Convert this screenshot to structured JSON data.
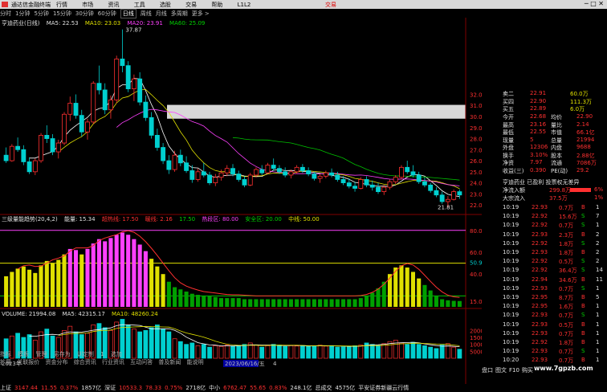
{
  "window": {
    "title": "通达信金融终端",
    "menus": [
      "行情",
      "市场",
      "资讯",
      "工具",
      "选股",
      "交易",
      "帮助",
      "L1L2"
    ],
    "brand": "交易",
    "controls": [
      "─",
      "□",
      "✕"
    ]
  },
  "toolbar": {
    "periods": [
      "分时",
      "1分钟",
      "5分钟",
      "15分钟",
      "30分钟",
      "60分钟",
      "日线",
      "周线",
      "月线",
      "多周期",
      "更多 >"
    ],
    "active": "日线"
  },
  "main_legend": {
    "stock": "亨迪药业(日线)",
    "ma5": "MA5: 22.53",
    "ma10": "MA10: 23.03",
    "ma20": "MA20: 23.91",
    "ma60": "MA60: 25.09",
    "high_label": "37.87",
    "range_label": "31.05 - 29.80",
    "low_label": "21.81"
  },
  "price_axis": [
    "32.00",
    "31.00",
    "30.00",
    "29.00",
    "28.00",
    "27.00",
    "26.00",
    "25.00",
    "24.00",
    "23.00",
    "22.00"
  ],
  "ind_legend": {
    "name": "三级量能趋势(20,4,2)",
    "value": "能量: 15.34",
    "items": [
      "超热线: 17.50",
      "暖线: 2.16",
      "17.50",
      "热段区: 80.00",
      "安全区: 20.00",
      "中线: 50.00"
    ]
  },
  "ind_axis": [
    "80.00",
    "60.00",
    "50.97",
    "40.00",
    "15.00"
  ],
  "vol_legend": {
    "vol": "VOLUME: 21994.08",
    "ma5": "MA5: 42315.17",
    "ma10": "MA10: 48260.24"
  },
  "vol_axis": [
    "20000",
    "15000",
    "10000",
    "5000"
  ],
  "date_labels": [
    "2023年",
    "2023/06/16/五",
    "4"
  ],
  "bottom_tabs": [
    "指标",
    "模板",
    "管理",
    "另存为",
    "训定制",
    "1",
    "选加"
  ],
  "bottom_tabs2": [
    "扩展",
    "关联报价",
    "资金分布",
    "综合资讯",
    "行业资讯",
    "互动问答",
    "普及新闻",
    "能说明"
  ],
  "side_quote": {
    "rows": [
      {
        "l": "卖二",
        "v": "22.91",
        "r": "60.0万"
      },
      {
        "l": "买四",
        "v": "22.90",
        "r": "111.3万"
      },
      {
        "l": "买五",
        "v": "22.89",
        "r": "6.0万"
      },
      {
        "l": "今开",
        "v": "22.68",
        "l2": "均价",
        "v2": "22.90"
      },
      {
        "l": "最高",
        "v": "23.16",
        "l2": "量比",
        "v2": "2.14"
      },
      {
        "l": "最低",
        "v": "22.55",
        "l2": "市值",
        "v2": "66.1亿"
      },
      {
        "l": "现量",
        "v": "5",
        "l2": "总量",
        "v2": "21994"
      },
      {
        "l": "外盘",
        "v": "12306",
        "l2": "内盘",
        "v2": "9688"
      },
      {
        "l": "换手",
        "v": "3.10%",
        "l2": "股本",
        "v2": "2.88亿"
      },
      {
        "l": "净资",
        "v": "7.97",
        "l2": "流通",
        "v2": "7086万"
      },
      {
        "l": "收益(三)",
        "v": "0.390",
        "l2": "PE(动)",
        "v2": "29.2"
      }
    ],
    "news": "亨迪药业 已盈利 投票权无差异",
    "flow1_label": "净流入额",
    "flow1_value": "299.8万",
    "flow1_pct": "6%",
    "flow2_label": "大宗流入",
    "flow2_value": "37.5万",
    "flow2_pct": "1%"
  },
  "ticks": [
    [
      "10:19",
      "22.93",
      "0.7万",
      "B",
      "1"
    ],
    [
      "10:19",
      "22.92",
      "15.6万",
      "S",
      "7"
    ],
    [
      "10:19",
      "22.92",
      "0.7万",
      "S",
      "1"
    ],
    [
      "10:19",
      "22.93",
      "2.3万",
      "B",
      "2"
    ],
    [
      "10:19",
      "22.92",
      "1.8万",
      "S",
      "2"
    ],
    [
      "10:19",
      "22.93",
      "1.8万",
      "B",
      "2"
    ],
    [
      "10:19",
      "22.92",
      "0.5万",
      "S",
      "2"
    ],
    [
      "10:19",
      "22.92",
      "36.4万",
      "S",
      "14"
    ],
    [
      "10:19",
      "22.94",
      "34.6万",
      "B",
      "11"
    ],
    [
      "10:19",
      "22.93",
      "0.7万",
      "S",
      "1"
    ],
    [
      "10:19",
      "22.95",
      "8.7万",
      "B",
      "5"
    ],
    [
      "10:19",
      "22.95",
      "1.6万",
      "B",
      "1"
    ],
    [
      "10:19",
      "22.93",
      "0.7万",
      "S",
      "1"
    ],
    [
      "10:19",
      "22.93",
      "0.5万",
      "B",
      "1"
    ],
    [
      "10:19",
      "22.93",
      "0.7万",
      "B",
      "1"
    ],
    [
      "10:19",
      "22.92",
      "1.8万",
      "B",
      "1"
    ],
    [
      "10:19",
      "22.93",
      "0.7万",
      "S",
      "1"
    ],
    [
      "10:20",
      "22.93",
      "0.7万",
      "B",
      "1"
    ]
  ],
  "side_tabs": [
    "盘口",
    "图文",
    "F10",
    "购买"
  ],
  "status": {
    "items": [
      {
        "name": "上证",
        "price": "3147.44",
        "chg": "11.55",
        "pct": "0.37%",
        "amt": "1857亿"
      },
      {
        "name": "深证",
        "price": "10533.3",
        "chg": "78.33",
        "pct": "0.75%",
        "amt": "2718亿"
      },
      {
        "name": "中小",
        "price": "6762.47",
        "chg": "55.65",
        "pct": "0.83%",
        "amt": "248.1亿"
      }
    ],
    "extra1": "总成交",
    "extra2": "4575亿",
    "extra3": "平安证券新疆云行情"
  },
  "watermark": "www.7gpzb.com",
  "colors": {
    "up": "#ff3030",
    "down": "#00d0d0",
    "ma5": "#ffffff",
    "ma10": "#e0e000",
    "ma20": "#ff40ff",
    "ma60": "#00c000"
  },
  "chart_data": {
    "type": "candlestick",
    "ohlc": [
      [
        26.5,
        27.2,
        25.8,
        26.0
      ],
      [
        26.0,
        27.5,
        25.9,
        27.3
      ],
      [
        27.3,
        28.1,
        26.8,
        27.0
      ],
      [
        27.0,
        27.4,
        25.6,
        25.9
      ],
      [
        25.9,
        26.3,
        24.8,
        25.0
      ],
      [
        25.0,
        26.2,
        24.7,
        26.0
      ],
      [
        26.0,
        28.5,
        25.8,
        28.3
      ],
      [
        28.3,
        29.2,
        27.6,
        28.0
      ],
      [
        28.0,
        28.4,
        26.5,
        26.8
      ],
      [
        26.8,
        27.9,
        26.2,
        27.6
      ],
      [
        27.6,
        30.4,
        27.4,
        30.2
      ],
      [
        30.2,
        31.8,
        29.6,
        31.2
      ],
      [
        31.2,
        32.0,
        29.8,
        30.1
      ],
      [
        30.1,
        30.6,
        28.2,
        28.6
      ],
      [
        28.6,
        29.8,
        27.9,
        29.5
      ],
      [
        29.5,
        33.2,
        29.3,
        33.0
      ],
      [
        33.0,
        34.6,
        32.0,
        32.4
      ],
      [
        32.4,
        33.0,
        30.2,
        30.6
      ],
      [
        30.6,
        31.9,
        29.8,
        31.5
      ],
      [
        31.5,
        35.5,
        31.2,
        35.2
      ],
      [
        35.2,
        37.87,
        34.0,
        34.6
      ],
      [
        34.6,
        35.0,
        32.2,
        32.5
      ],
      [
        32.5,
        33.8,
        31.4,
        33.4
      ],
      [
        33.4,
        34.0,
        31.0,
        31.3
      ],
      [
        31.3,
        31.9,
        29.6,
        29.9
      ],
      [
        29.9,
        30.4,
        28.0,
        28.3
      ],
      [
        28.3,
        28.9,
        26.9,
        27.2
      ],
      [
        27.2,
        27.6,
        25.7,
        26.0
      ],
      [
        26.0,
        26.5,
        24.8,
        25.2
      ],
      [
        25.2,
        26.9,
        25.0,
        26.5
      ],
      [
        26.5,
        27.0,
        25.5,
        25.8
      ],
      [
        25.8,
        26.4,
        24.9,
        25.1
      ],
      [
        25.1,
        25.6,
        24.0,
        24.3
      ],
      [
        24.3,
        25.3,
        24.1,
        25.0
      ],
      [
        25.0,
        25.8,
        24.5,
        24.7
      ],
      [
        24.7,
        25.0,
        23.8,
        24.0
      ],
      [
        24.0,
        24.8,
        23.7,
        24.5
      ],
      [
        24.5,
        25.2,
        24.2,
        24.9
      ],
      [
        24.9,
        25.6,
        24.6,
        25.3
      ],
      [
        25.3,
        25.7,
        24.6,
        24.8
      ],
      [
        24.8,
        25.1,
        24.1,
        24.3
      ],
      [
        24.3,
        24.6,
        23.6,
        23.8
      ],
      [
        23.8,
        24.9,
        23.7,
        24.7
      ],
      [
        24.7,
        25.4,
        24.5,
        25.2
      ],
      [
        25.2,
        25.6,
        24.7,
        24.9
      ],
      [
        24.9,
        25.8,
        24.8,
        25.6
      ],
      [
        25.6,
        26.2,
        25.1,
        25.3
      ],
      [
        25.3,
        25.6,
        24.8,
        25.0
      ],
      [
        25.0,
        25.4,
        24.5,
        24.7
      ],
      [
        24.7,
        25.2,
        24.4,
        25.0
      ],
      [
        25.0,
        25.6,
        24.8,
        25.4
      ],
      [
        25.4,
        25.7,
        24.9,
        25.1
      ],
      [
        25.1,
        25.4,
        24.6,
        24.8
      ],
      [
        24.8,
        25.0,
        24.2,
        24.4
      ],
      [
        24.4,
        24.8,
        24.0,
        24.6
      ],
      [
        24.6,
        25.1,
        24.4,
        24.9
      ],
      [
        24.9,
        25.3,
        24.5,
        24.7
      ],
      [
        24.7,
        25.0,
        24.1,
        24.3
      ],
      [
        24.3,
        24.6,
        23.8,
        24.0
      ],
      [
        24.0,
        24.4,
        23.5,
        23.7
      ],
      [
        23.7,
        24.1,
        23.2,
        23.5
      ],
      [
        23.5,
        24.5,
        23.4,
        24.3
      ],
      [
        24.3,
        24.6,
        23.6,
        23.8
      ],
      [
        23.8,
        24.2,
        23.3,
        23.6
      ],
      [
        23.6,
        24.0,
        23.0,
        23.2
      ],
      [
        23.2,
        23.8,
        22.9,
        23.6
      ],
      [
        23.6,
        24.3,
        23.4,
        24.1
      ],
      [
        24.1,
        24.7,
        23.9,
        24.5
      ],
      [
        24.5,
        25.6,
        24.3,
        25.4
      ],
      [
        25.4,
        26.0,
        24.8,
        25.0
      ],
      [
        25.0,
        25.6,
        24.5,
        24.7
      ],
      [
        24.7,
        25.0,
        23.9,
        24.1
      ],
      [
        24.1,
        24.5,
        23.6,
        23.8
      ],
      [
        23.8,
        24.0,
        23.1,
        23.3
      ],
      [
        23.3,
        23.6,
        22.7,
        22.9
      ],
      [
        22.9,
        23.2,
        22.1,
        22.3
      ],
      [
        22.3,
        22.8,
        21.81,
        22.5
      ],
      [
        22.5,
        23.4,
        22.4,
        23.2
      ],
      [
        23.2,
        23.4,
        22.55,
        22.9
      ]
    ],
    "energy": [
      38,
      42,
      45,
      47,
      44,
      41,
      48,
      52,
      50,
      53,
      58,
      63,
      62,
      58,
      63,
      68,
      72,
      70,
      73,
      76,
      78,
      76,
      72,
      67,
      61,
      54,
      47,
      40,
      33,
      28,
      26,
      24,
      22,
      21,
      20,
      20,
      19,
      18,
      18,
      18,
      18,
      17,
      17,
      17,
      17,
      17,
      17,
      17,
      17,
      17,
      17,
      17,
      17,
      17,
      17,
      17,
      17,
      17,
      17,
      17,
      17,
      18,
      20,
      23,
      27,
      33,
      40,
      46,
      48,
      46,
      42,
      36,
      30,
      25,
      20,
      17,
      16,
      15.5,
      15.34
    ],
    "volume": [
      14000,
      16000,
      18000,
      15000,
      17000,
      13000,
      19000,
      21000,
      16000,
      15000,
      20000,
      23000,
      19000,
      17000,
      18000,
      24000,
      25000,
      22000,
      20000,
      26000,
      28000,
      24000,
      21000,
      19000,
      20000,
      22000,
      24000,
      21000,
      19000,
      14000,
      12000,
      10000,
      11000,
      9000,
      10000,
      8000,
      9000,
      8500,
      9500,
      8800,
      9000,
      10000,
      11000,
      9500,
      8000,
      9000,
      10000,
      9500,
      8500,
      9000,
      8800,
      9200,
      8600,
      8900,
      9400,
      8700,
      9100,
      8000,
      8300,
      8600,
      9000,
      9500,
      11000,
      10000,
      9200,
      10500,
      12000,
      13000,
      11000,
      10000,
      11500,
      10000,
      9000,
      8000,
      7000,
      9500,
      10500,
      8000,
      6500
    ]
  }
}
